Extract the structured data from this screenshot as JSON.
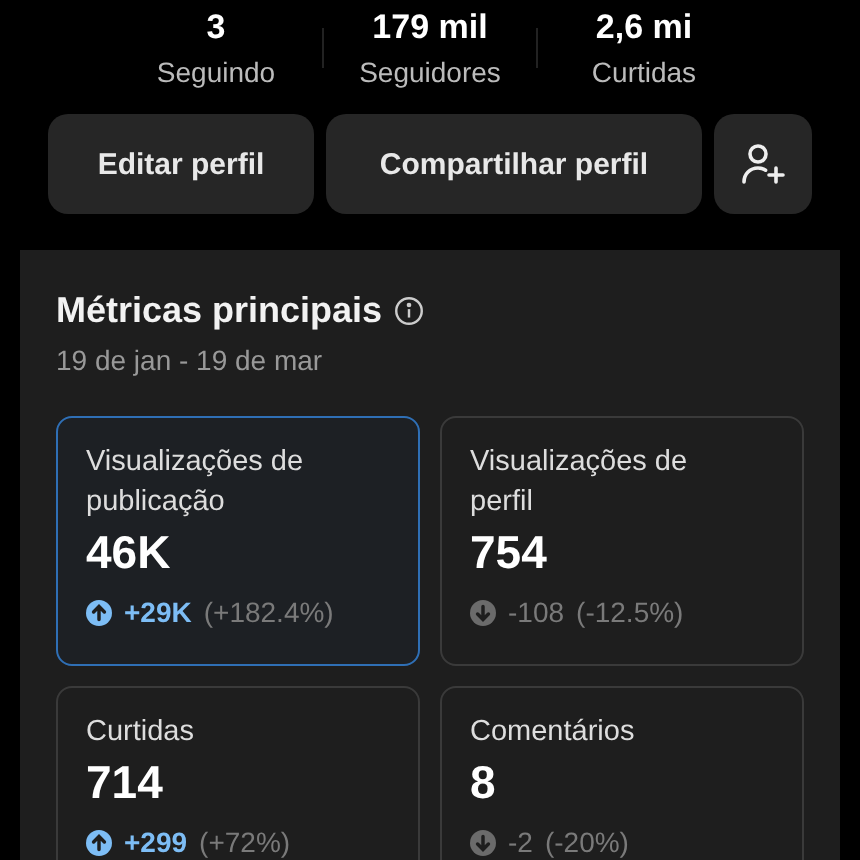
{
  "stats": [
    {
      "value": "3",
      "label": "Seguindo"
    },
    {
      "value": "179 mil",
      "label": "Seguidores"
    },
    {
      "value": "2,6 mi",
      "label": "Curtidas"
    }
  ],
  "buttons": [
    {
      "label": "Editar perfil"
    },
    {
      "label": "Compartilhar perfil"
    }
  ],
  "metrics": {
    "title": "Métricas principais",
    "date_range": "19 de jan - 19 de mar",
    "cards": [
      {
        "label": "Visualizações de publicação",
        "value": "46K",
        "kind": "up",
        "delta": "+29K",
        "percent": "(+182.4%)",
        "selected": true
      },
      {
        "label": "Visualizações de perfil",
        "value": "754",
        "kind": "down",
        "delta": "-108",
        "percent": "(-12.5%)",
        "selected": false
      },
      {
        "label": "Curtidas",
        "value": "714",
        "kind": "up",
        "delta": "+299",
        "percent": "(+72%)",
        "selected": false
      },
      {
        "label": "Comentários",
        "value": "8",
        "kind": "down",
        "delta": "-2",
        "percent": "(-20%)",
        "selected": false
      }
    ]
  }
}
